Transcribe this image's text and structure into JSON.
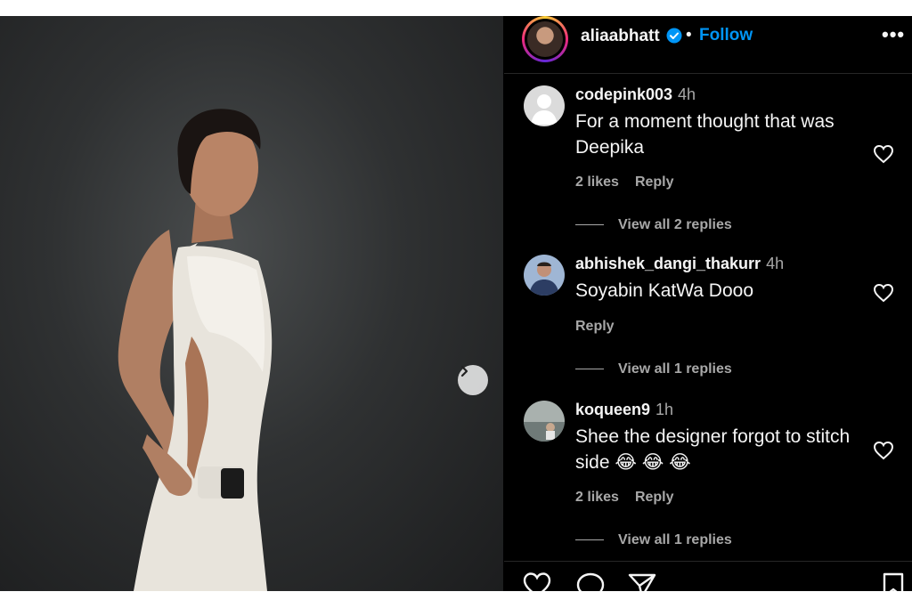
{
  "post": {
    "username": "aliaabhatt",
    "separator": "•",
    "follow_label": "Follow",
    "more_label": "•••"
  },
  "comments": [
    {
      "username": "codepink003",
      "time": "4h",
      "text": "For a moment thought that was Deepika",
      "likes": "2 likes",
      "reply_label": "Reply",
      "view_replies": "View all 2 replies"
    },
    {
      "username": "abhishek_dangi_thakurr",
      "time": "4h",
      "text": "Soyabin KatWa Dooo",
      "reply_label": "Reply",
      "view_replies": "View all 1 replies"
    },
    {
      "username": "koqueen9",
      "time": "1h",
      "text": "Shee the designer forgot to stitch side",
      "emoji": "😂 😂 😂",
      "likes": "2 likes",
      "reply_label": "Reply",
      "view_replies": "View all 1 replies"
    }
  ],
  "colors": {
    "accent": "#0095f6",
    "panel_bg": "#000000",
    "muted_text": "#a8a8a8"
  }
}
